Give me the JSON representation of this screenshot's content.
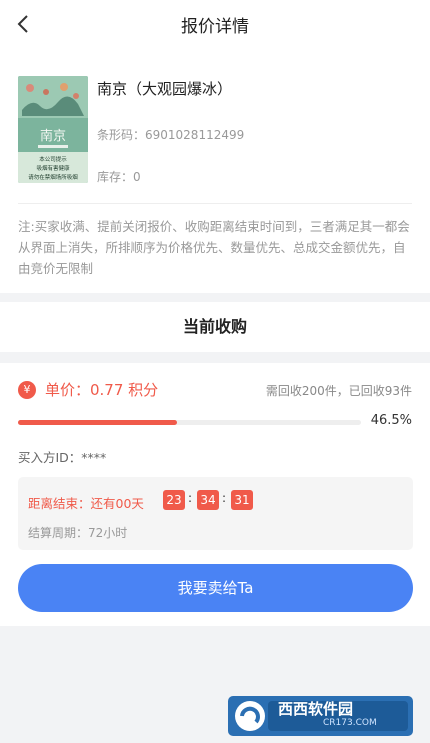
{
  "header": {
    "title": "报价详情"
  },
  "product": {
    "name": "南京（大观园爆冰）",
    "barcode": "条形码：6901028112499",
    "stock": "库存：0",
    "pack_brand": "南京",
    "pack_warning": [
      "本公司提示",
      "吸烟有害健康",
      "请勿在禁烟场所吸烟"
    ]
  },
  "notice": "注:买家收满、提前关闭报价、收购距离结束时间到，三者满足其一都会从界面上消失，所排顺序为价格优先、数量优先、总成交金额优先，自由竞价无限制",
  "section": {
    "title": "当前收购"
  },
  "purchase": {
    "currency_symbol": "¥",
    "unit_price": "单价：0.77 积分",
    "progress_text": "需回收200件，已回收93件",
    "progress_fraction": 0.465,
    "progress_percent": "46.5%",
    "buyer_id": "买入方ID：****",
    "countdown": {
      "label": "距离结束：还有00天",
      "hours": "23",
      "minutes": "34",
      "seconds": "31",
      "sep": ":"
    },
    "cycle": "结算周期：72小时",
    "sell_button": "我要卖给Ta"
  },
  "watermark": {
    "site": "西西软件园",
    "domain": "CR173.COM"
  },
  "colors": {
    "accent_red": "#f05a4a",
    "primary_blue": "#4a83f4",
    "background": "#f2f3f5"
  }
}
